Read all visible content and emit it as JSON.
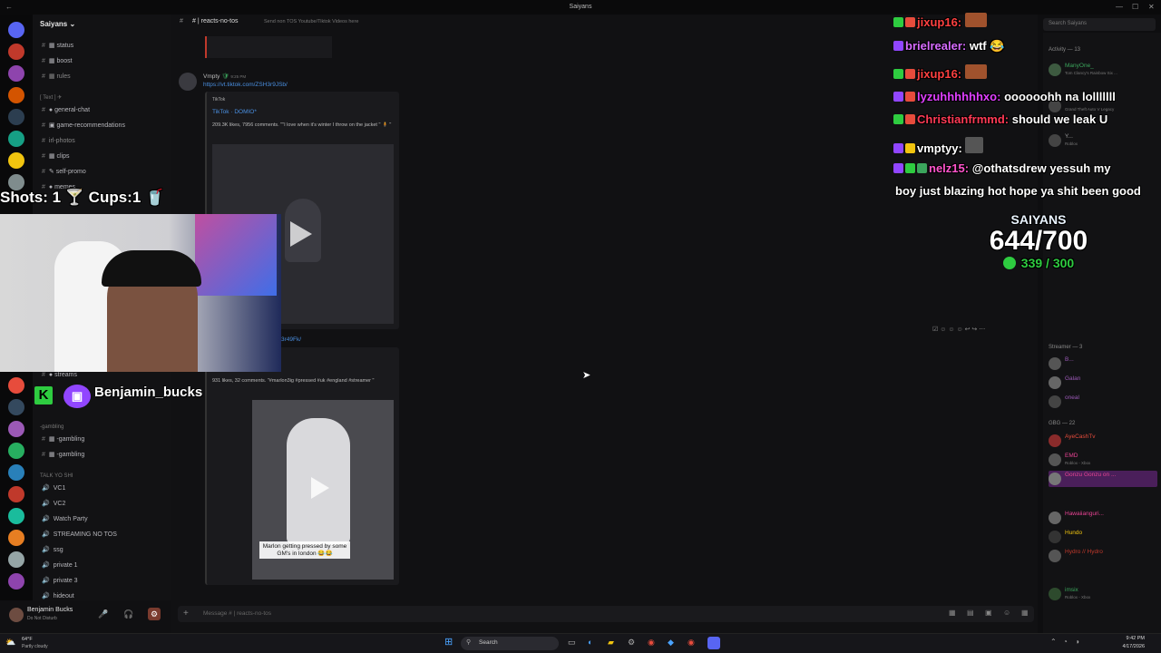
{
  "window": {
    "title": "Saiyans"
  },
  "server": {
    "name": "Saiyans"
  },
  "sidebar": {
    "top_channels": [
      "status",
      "boost",
      "rules"
    ],
    "text_category": "[ Text ] ✈",
    "channels": [
      "general-chat",
      "game-recommendations",
      "irl-photos",
      "clips",
      "self-promo",
      "memes"
    ],
    "streams_channel": "streams",
    "gambling_category": "-gambling",
    "gambling_channels": [
      "-gambling",
      "-gambling"
    ],
    "voice_category": "TALK YO SHI",
    "voice_channels": [
      "VC1",
      "VC2",
      "Watch Party",
      "STREAMING NO TOS",
      "ssg",
      "private 1",
      "private 3",
      "hideout"
    ]
  },
  "user": {
    "name": "Benjamin Bucks",
    "status": "Do Not Disturb"
  },
  "channel": {
    "name": "reacts-no-tos",
    "topic": "Send non TOS Youtube/Tiktok Videos here"
  },
  "messages": [
    {
      "author": "Vmpty",
      "time": "9:25 PM",
      "link": "https://vt.tiktok.com/ZSH3r9JSb/",
      "embed_provider": "TikTok",
      "embed_title": "TikTok · DOMIO*",
      "embed_desc": "209.3K likes, 7956 comments. \"\"I love when it's winter I throw on the jacket \" 🧍 \""
    },
    {
      "link_tail": "3r49Fk/",
      "embed_desc": "931 likes, 32 comments. \"#marlon3ig #pressed #uk #england #streamer \"",
      "caption": "Marlon getting pressed by some GM's in london 😂😂"
    }
  ],
  "composer": {
    "placeholder": "Message # | reacts-no-tos"
  },
  "members": {
    "search_placeholder": "Search Saiyans",
    "activity_header": "Activity — 13",
    "activities": [
      {
        "name": "ManyOne_",
        "status": "Tom Clancy's Rainbow Six ..."
      },
      {
        "name": "",
        "status": "Grand Theft Auto V Legacy"
      },
      {
        "name": "Y...",
        "status": "Roblox"
      }
    ],
    "streamer_header": "Streamer — 3",
    "streamers": [
      "B...",
      "Galan",
      "oneal"
    ],
    "gbg_header": "GBG — 22",
    "gbg": [
      "AyeCashTv",
      "EMD",
      "Gonzu Gonzu on ...",
      "Hawaiianguri...",
      "Hundo",
      "Hydro // Hydro",
      "imsix"
    ],
    "gbg_status": [
      "",
      "Roblox - Xbox",
      "",
      "",
      "",
      "",
      "Roblox - Xbox"
    ]
  },
  "overlay": {
    "shots": "Shots: 1 🍸 Cups:1 🥤",
    "twitch_name": "Benjamin_bucks",
    "goal_title": "SAIYANS",
    "goal_main": "644/700",
    "goal_sub": "339 / 300",
    "chat": [
      {
        "user": "jixup16:",
        "text": "",
        "color": "#ff4040"
      },
      {
        "user": "brielrealer:",
        "text": "wtf 😂",
        "color": "#d76cff"
      },
      {
        "user": "jixup16:",
        "text": "",
        "color": "#ff4040"
      },
      {
        "user": "lyzuhhhhhhxo:",
        "text": "oooooohh na lolllllll",
        "color": "#e040ff"
      },
      {
        "user": "Christianfrmmd:",
        "text": "should we leak U",
        "color": "#ff3a55"
      },
      {
        "user": "vmptyy:",
        "text": "",
        "color": "#ffffff"
      },
      {
        "user": "nelz15:",
        "text": "@othatsdrew yessuh my",
        "color": "#ff55cc"
      },
      {
        "user": "",
        "text": "boy just blazing hot hope ya shit been good",
        "color": "#ffffff"
      }
    ]
  },
  "taskbar": {
    "weather_temp": "64°F",
    "weather_desc": "Partly cloudy",
    "search": "Search",
    "time": "9:42 PM",
    "date": "4/17/2026"
  },
  "colors": {
    "accent": "#5865f2",
    "link": "#4a8fe0",
    "twitch": "#9146ff",
    "goal_green": "#2ecc40"
  }
}
